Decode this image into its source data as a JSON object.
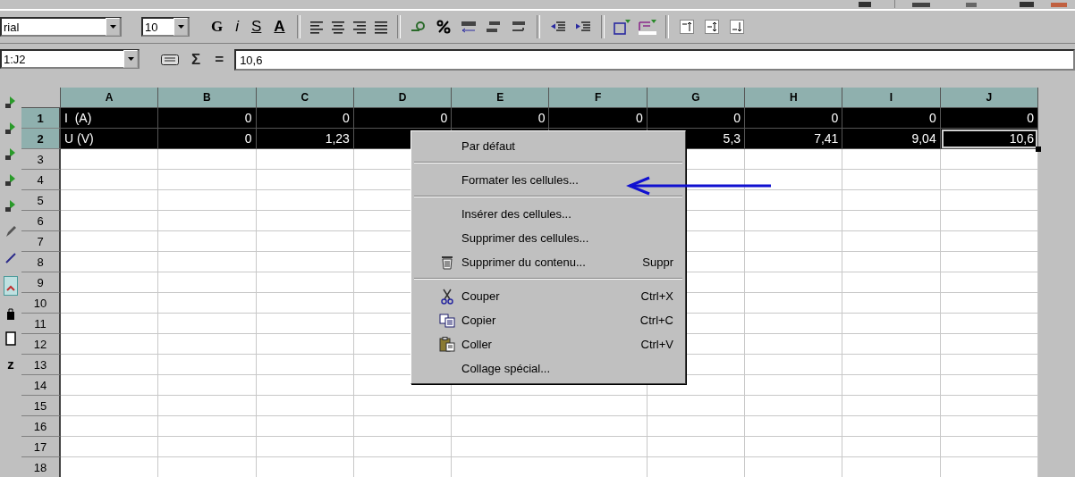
{
  "side_toolbar": {
    "bottom_label": "z"
  },
  "toolbar": {
    "font_name": "rial",
    "font_size": "10",
    "format_buttons": [
      {
        "kind": "bold",
        "label": "G"
      },
      {
        "kind": "italic",
        "label": "i"
      },
      {
        "kind": "underline",
        "label": "S"
      },
      {
        "kind": "color",
        "label": "A"
      }
    ]
  },
  "formula_bar": {
    "name_box": "1:J2",
    "sum_label": "Σ",
    "equals_label": "=",
    "value": "10,6"
  },
  "grid": {
    "columns": [
      "A",
      "B",
      "C",
      "D",
      "E",
      "F",
      "G",
      "H",
      "I",
      "J"
    ],
    "rows": [
      {
        "number": "1",
        "selected": true,
        "cells": [
          {
            "value": "I  (A)",
            "active": false
          },
          {
            "value": "0",
            "active": false
          },
          {
            "value": "0",
            "active": false
          },
          {
            "value": "0",
            "active": false
          },
          {
            "value": "0",
            "active": false
          },
          {
            "value": "0",
            "active": false
          },
          {
            "value": "0",
            "active": false
          },
          {
            "value": "0",
            "active": false
          },
          {
            "value": "0",
            "active": false
          },
          {
            "value": "0",
            "active": false
          }
        ]
      },
      {
        "number": "2",
        "selected": true,
        "cells": [
          {
            "value": "U (V)",
            "active": false
          },
          {
            "value": "0",
            "active": false
          },
          {
            "value": "1,23",
            "active": false
          },
          {
            "active": false
          },
          {
            "active": false
          },
          {
            "active": false
          },
          {
            "value": "5,3",
            "active": false
          },
          {
            "value": "7,41",
            "active": false
          },
          {
            "value": "9,04",
            "active": false
          },
          {
            "value": "10,6",
            "active": true
          }
        ]
      },
      {
        "number": "3",
        "selected": false
      },
      {
        "number": "4",
        "selected": false
      },
      {
        "number": "5",
        "selected": false
      },
      {
        "number": "6",
        "selected": false
      },
      {
        "number": "7",
        "selected": false
      },
      {
        "number": "8",
        "selected": false
      },
      {
        "number": "9",
        "selected": false
      },
      {
        "number": "10",
        "selected": false
      },
      {
        "number": "11",
        "selected": false
      },
      {
        "number": "12",
        "selected": false
      },
      {
        "number": "13",
        "selected": false
      },
      {
        "number": "14",
        "selected": false
      },
      {
        "number": "15",
        "selected": false
      },
      {
        "number": "16",
        "selected": false
      },
      {
        "number": "17",
        "selected": false
      },
      {
        "number": "18",
        "selected": false
      }
    ]
  },
  "context_menu": {
    "items": [
      {
        "kind": "item",
        "label": "Par défaut"
      },
      {
        "kind": "separator"
      },
      {
        "kind": "item",
        "label": "Formater les cellules..."
      },
      {
        "kind": "separator"
      },
      {
        "kind": "item",
        "label": "Insérer des cellules..."
      },
      {
        "kind": "item",
        "label": "Supprimer des cellules..."
      },
      {
        "kind": "item",
        "label": "Supprimer du contenu...",
        "shortcut": "Suppr"
      },
      {
        "kind": "separator"
      },
      {
        "kind": "item",
        "label": "Couper",
        "shortcut": "Ctrl+X"
      },
      {
        "kind": "item",
        "label": "Copier",
        "shortcut": "Ctrl+C"
      },
      {
        "kind": "item",
        "label": "Coller",
        "shortcut": "Ctrl+V"
      },
      {
        "kind": "item",
        "label": "Collage spécial..."
      }
    ]
  }
}
